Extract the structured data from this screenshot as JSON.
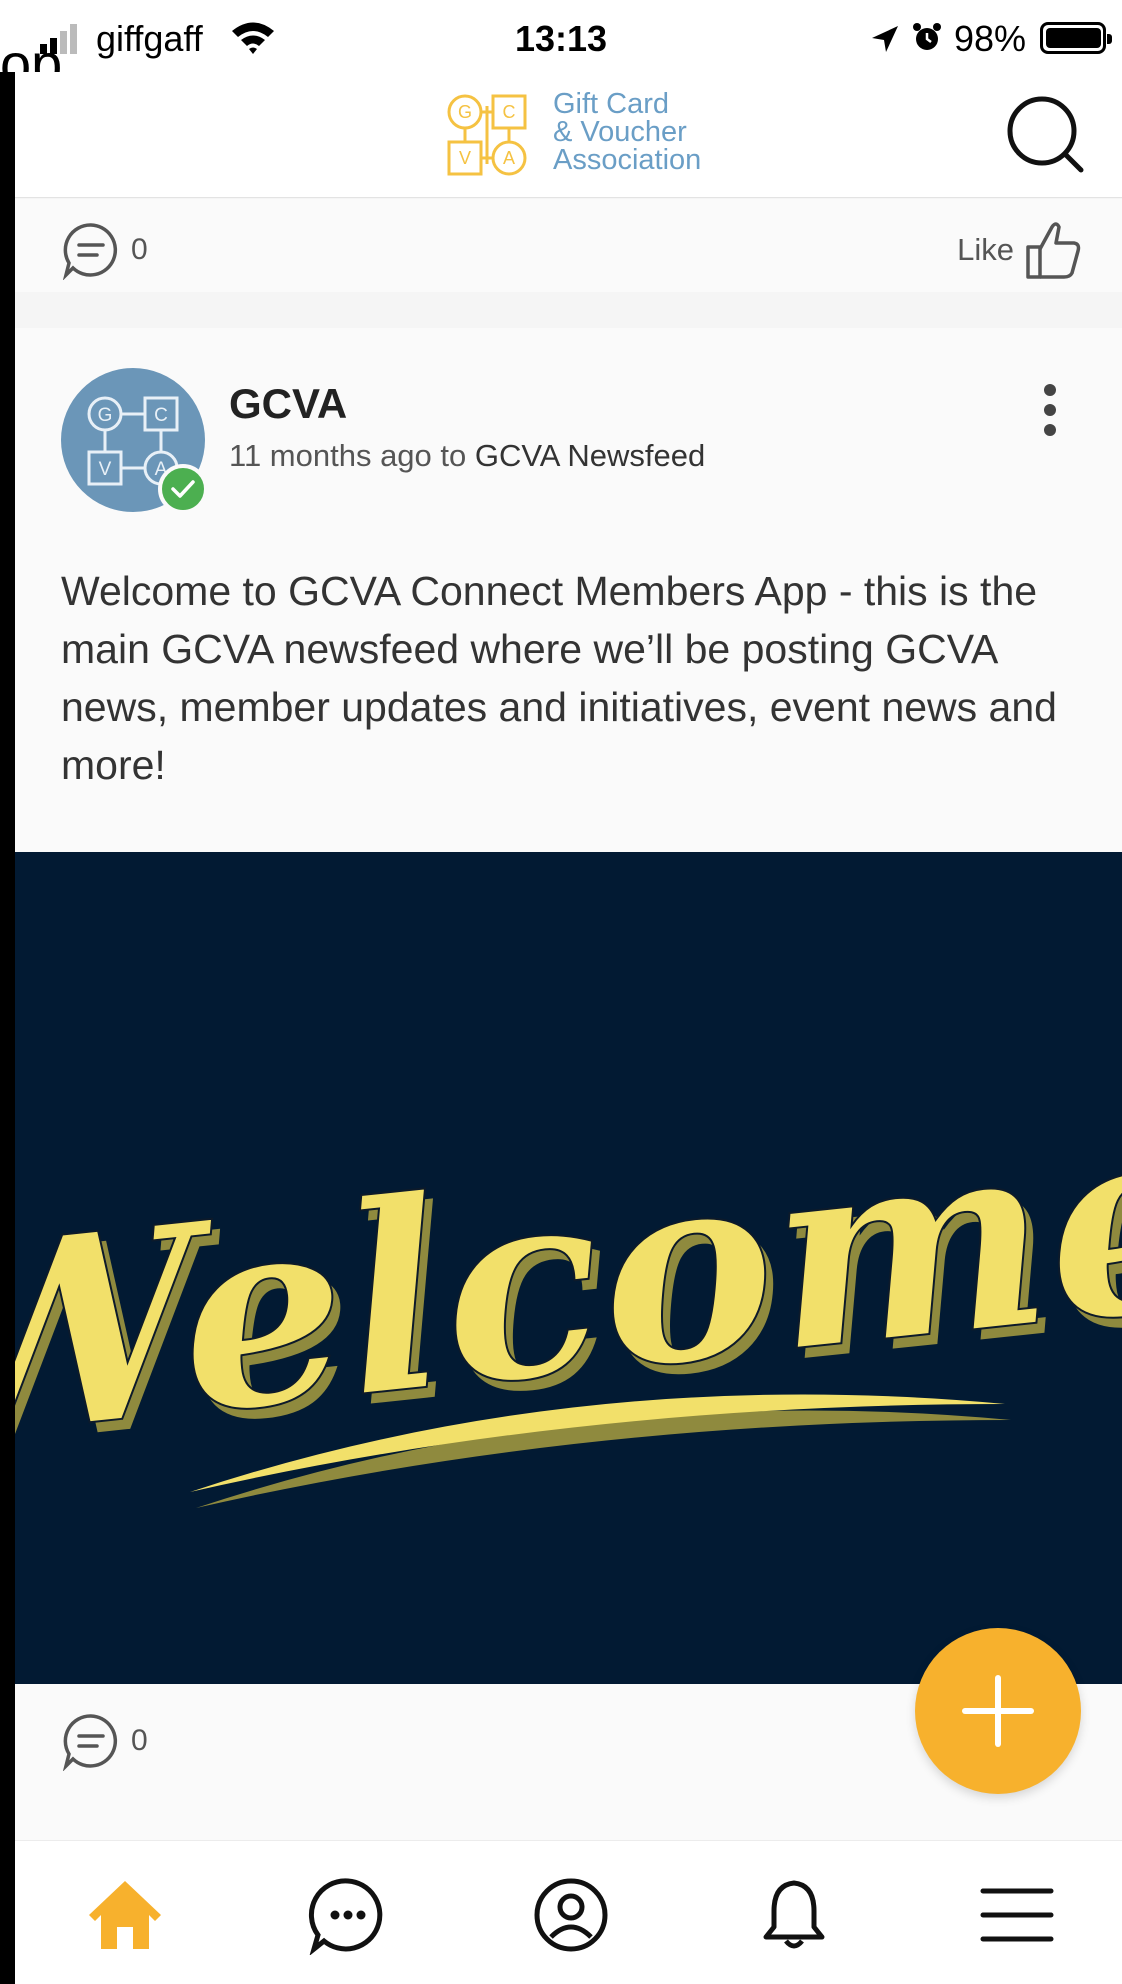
{
  "status_bar": {
    "overlay_text": "op",
    "carrier": "giffgaff",
    "time": "13:13",
    "battery_percent": "98%",
    "battery_level": 0.98
  },
  "header": {
    "logo_text": [
      "Gift Card",
      "& Voucher",
      "Association"
    ],
    "logo_letters": [
      "G",
      "C",
      "V",
      "A"
    ],
    "search_icon": "search-icon"
  },
  "feed": {
    "previous_post": {
      "comment_count": "0",
      "like_label": "Like"
    },
    "post": {
      "avatar_letters": [
        "G",
        "C",
        "V",
        "A"
      ],
      "author": "GCVA",
      "time_ago": "11 months ago to",
      "destination": "GCVA Newsfeed",
      "body": "Welcome to GCVA Connect Members App - this is the main GCVA newsfeed where we’ll be posting GCVA news, member updates and initiatives, event news and more!",
      "image_text": "Welcome",
      "comment_count": "0"
    }
  },
  "fab_icon": "plus-icon",
  "bottom_nav": {
    "items": [
      {
        "name": "home",
        "icon": "home-icon",
        "active": true
      },
      {
        "name": "messages",
        "icon": "chat-icon",
        "active": false
      },
      {
        "name": "profile",
        "icon": "profile-icon",
        "active": false
      },
      {
        "name": "notifications",
        "icon": "bell-icon",
        "active": false
      },
      {
        "name": "menu",
        "icon": "menu-icon",
        "active": false
      }
    ]
  },
  "colors": {
    "accent": "#f7b12d",
    "logo_blue": "#6a9ec6",
    "logo_yellow": "#f5c242",
    "image_background": "#021a33",
    "welcome_yellow": "#f2e06a",
    "verified_green": "#4caf50"
  }
}
